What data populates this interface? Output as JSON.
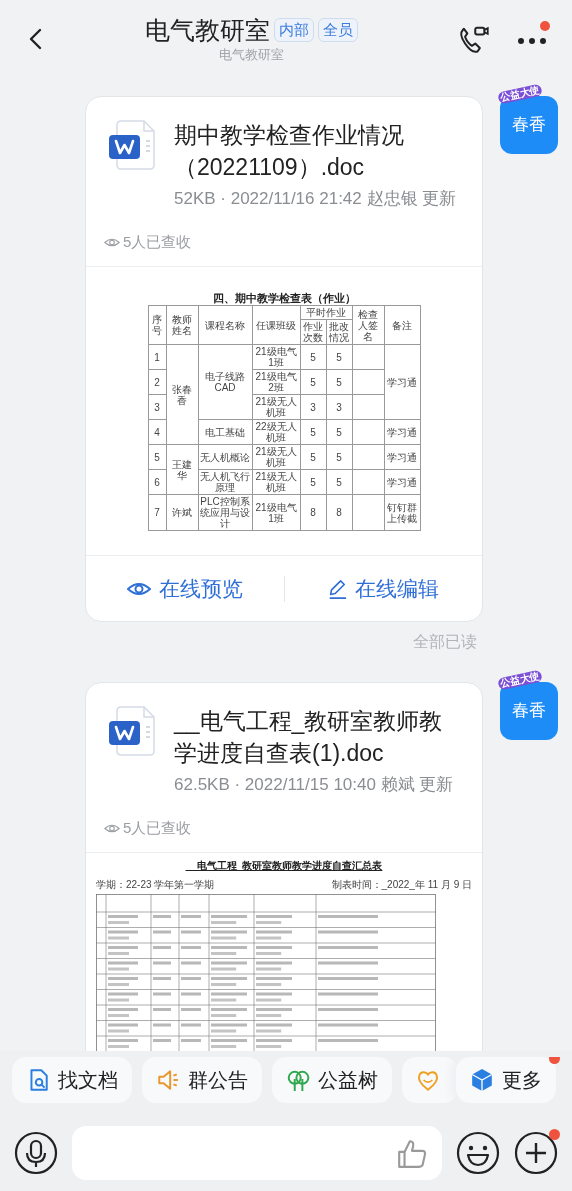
{
  "header": {
    "title": "电气教研室",
    "tags": [
      "内部",
      "全员"
    ],
    "subtitle": "电气教研室",
    "more_badge": true
  },
  "messages": [
    {
      "avatar": {
        "name": "春香",
        "ribbon": "公益大使"
      },
      "file": {
        "title": "期中教学检查作业情况（20221109）.doc",
        "meta": "52KB · 2022/11/16 21:42 赵忠银 更新",
        "views": "5人已查收",
        "preview": {
          "kind": "homework",
          "title": "四、期中教学检查表（作业）",
          "columns": [
            "序号",
            "教师姓名",
            "课程名称",
            "任课班级",
            "作业次数",
            "批改情况",
            "检查人签名",
            "备注"
          ],
          "group_column": "平时作业",
          "teachers": [
            {
              "name": "张春香",
              "courses": [
                {
                  "name": "电子线路 CAD",
                  "note": "学习通",
                  "classes": [
                    {
                      "no": "1",
                      "class": "21级电气1班",
                      "count": "5",
                      "checked": "5"
                    },
                    {
                      "no": "2",
                      "class": "21级电气2班",
                      "count": "5",
                      "checked": "5"
                    },
                    {
                      "no": "3",
                      "class": "21级无人机班",
                      "count": "3",
                      "checked": "3"
                    }
                  ]
                },
                {
                  "name": "电工基础",
                  "note": "学习通",
                  "classes": [
                    {
                      "no": "4",
                      "class": "22级无人机班",
                      "count": "5",
                      "checked": "5"
                    }
                  ]
                }
              ]
            },
            {
              "name": "王建华",
              "courses": [
                {
                  "name": "无人机概论",
                  "note": "学习通",
                  "classes": [
                    {
                      "no": "5",
                      "class": "21级无人机班",
                      "count": "5",
                      "checked": "5"
                    }
                  ]
                },
                {
                  "name": "无人机飞行原理",
                  "note": "学习通",
                  "classes": [
                    {
                      "no": "6",
                      "class": "21级无人机班",
                      "count": "5",
                      "checked": "5"
                    }
                  ]
                }
              ]
            },
            {
              "name": "许斌",
              "courses": [
                {
                  "name": "PLC控制系统应用与设计",
                  "note": "钉钉群上传截",
                  "classes": [
                    {
                      "no": "7",
                      "class": "21级电气1班",
                      "count": "8",
                      "checked": "8"
                    }
                  ]
                }
              ]
            }
          ]
        },
        "actions": [
          "在线预览",
          "在线编辑"
        ]
      },
      "read_status": "全部已读"
    },
    {
      "avatar": {
        "name": "春香",
        "ribbon": "公益大使"
      },
      "file": {
        "title": "__电气工程_教研室教师教学进度自查表(1).doc",
        "meta": "62.5KB · 2022/11/15 10:40 赖斌 更新",
        "views": "5人已查收",
        "preview": {
          "kind": "progress",
          "title": "__电气工程_教研室教师教学进度自查汇总表",
          "term": "学期：22-23 学年第一学期",
          "made": "制表时间：_2022_年 11 月 9 日"
        }
      }
    }
  ],
  "quick_actions": [
    {
      "kind": "find",
      "label": "找文档"
    },
    {
      "kind": "notice",
      "label": "群公告"
    },
    {
      "kind": "tree",
      "label": "公益树"
    },
    {
      "kind": "heart"
    },
    {
      "kind": "more",
      "label": "更多",
      "badge": true
    }
  ],
  "composer": {
    "plus_badge": true
  }
}
